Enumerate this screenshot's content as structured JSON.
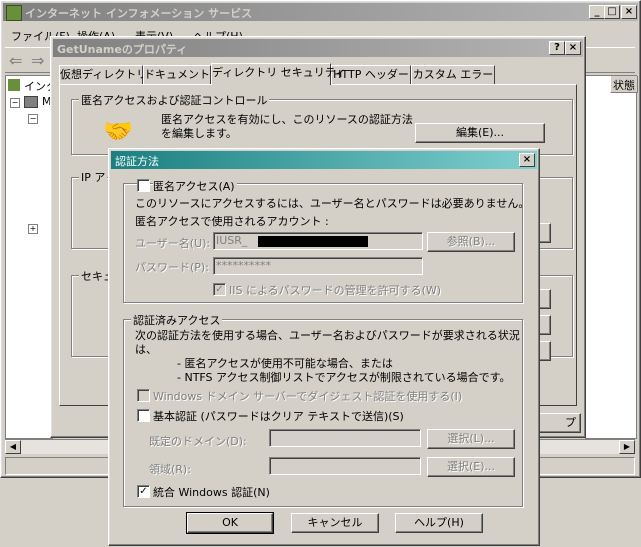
{
  "main_window": {
    "title": "インターネット インフォメーション サービス",
    "menu": [
      "ファイル(F)",
      "操作(A)",
      "表示(V)",
      "ヘルプ(H)"
    ],
    "tree_root": "インタ",
    "tree_item": "M",
    "column_status": "状態"
  },
  "props_dialog": {
    "title": "GetUnameのプロパティ",
    "tabs": [
      "仮想ディレクトリ",
      "ドキュメント",
      "ディレクトリ セキュリティ",
      "HTTP ヘッダー",
      "カスタム エラー"
    ],
    "active_tab": 2,
    "anon_group_label": "匿名アクセスおよび認証コントロール",
    "anon_desc_line1": "匿名アクセスを有効にし、このリソースの認証方法",
    "anon_desc_line2": "を編集します。",
    "edit_button": "編集(E)...",
    "ip_group_label": "IP ア",
    "secure_group_label": "セキュ",
    "help_button_partial": "プ"
  },
  "auth_dialog": {
    "title": "認証方法",
    "anon_checkbox_label": "匿名アクセス(A)",
    "anon_checked": false,
    "anon_info": "このリソースにアクセスするには、ユーザー名とパスワードは必要ありません。",
    "anon_account_label": "匿名アクセスで使用されるアカウント :",
    "username_label": "ユーザー名(U):",
    "username_value": "IUSR_",
    "browse_button": "参照(B)...",
    "password_label": "パスワード(P):",
    "password_value": "**********",
    "iis_pw_checkbox_label": "IIS によるパスワードの管理を許可する(W)",
    "iis_pw_checked": true,
    "auth_group_label": "認証済みアクセス",
    "auth_info_line1": "次の認証方法を使用する場合、ユーザー名およびパスワードが要求される状況",
    "auth_info_line2": "は、",
    "auth_bullet1": "- 匿名アクセスが使用不可能な場合、または",
    "auth_bullet2": "- NTFS アクセス制御リストでアクセスが制限されている場合です。",
    "digest_label": "Windows ドメイン サーバーでダイジェスト認証を使用する(I)",
    "digest_checked": false,
    "basic_label": "基本認証 (パスワードはクリア テキストで送信)(S)",
    "basic_checked": false,
    "domain_label": "既定のドメイン(D):",
    "domain_select": "選択(L)...",
    "realm_label": "領域(R):",
    "realm_select": "選択(E)...",
    "integrated_label": "統合 Windows 認証(N)",
    "integrated_checked": true,
    "ok_button": "OK",
    "cancel_button": "キャンセル",
    "help_button": "ヘルプ(H)",
    "check_mark": "✓"
  }
}
